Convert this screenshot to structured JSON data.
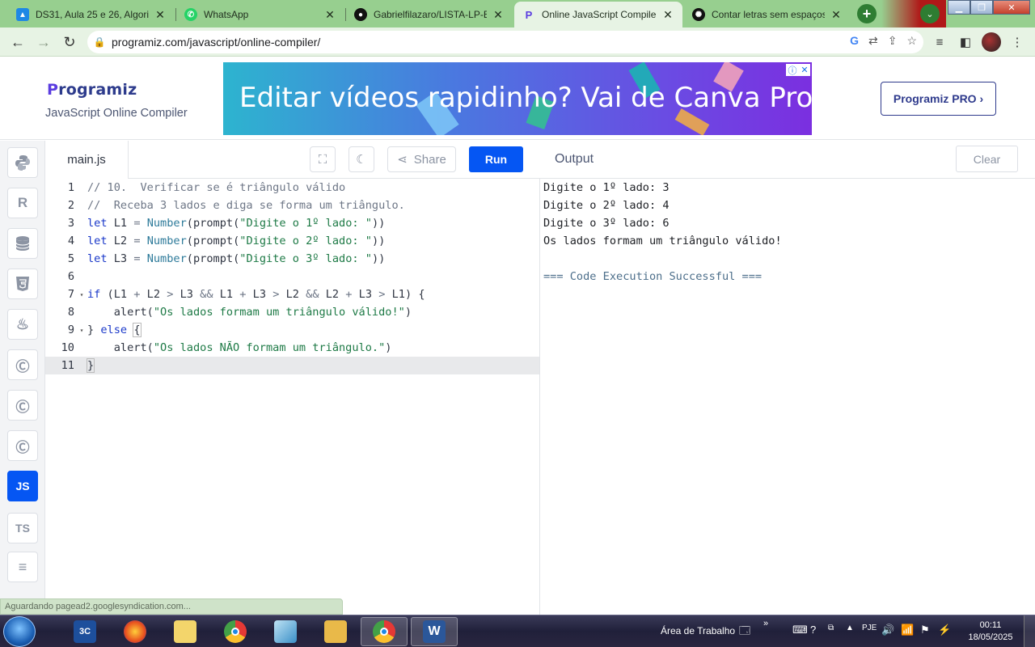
{
  "browser": {
    "tabs": [
      {
        "title": "DS31, Aula 25 e 26, Algoritmos",
        "icon": "classroom-icon",
        "color": "#1e88e5"
      },
      {
        "title": "WhatsApp",
        "icon": "whatsapp-icon",
        "color": "#25d366"
      },
      {
        "title": "Gabrielfilazaro/LISTA-LP-ET",
        "icon": "github-icon",
        "color": "#111111"
      },
      {
        "title": "Online JavaScript Compiler",
        "icon": "programiz-icon",
        "color": "#5a3ce0"
      },
      {
        "title": "Contar letras sem espaços",
        "icon": "openai-icon",
        "color": "#111111"
      }
    ],
    "url": "programiz.com/javascript/online-compiler/"
  },
  "header": {
    "logo_first": "P",
    "logo_rest": "rogramiz",
    "subtitle": "JavaScript Online Compiler",
    "ad_text": "Editar vídeos rapidinho? Vai de Canva Pro!",
    "pro_button": "Programiz PRO ›"
  },
  "languages": [
    "python",
    "r",
    "sql",
    "html",
    "java",
    "c",
    "cpp",
    "csharp",
    "JS",
    "TS",
    "go"
  ],
  "editor": {
    "file_tab": "main.js",
    "share_label": "Share",
    "run_label": "Run",
    "current_line": 11
  },
  "output": {
    "title": "Output",
    "clear_label": "Clear",
    "lines": [
      "Digite o 1º lado: 3",
      "Digite o 2º lado: 4",
      "Digite o 3º lado: 6",
      "Os lados formam um triângulo válido!",
      "",
      "=== Code Execution Successful ==="
    ]
  },
  "status_text": "Aguardando pagead2.googlesyndication.com...",
  "taskbar": {
    "desktop_label": "Área de Trabalho",
    "time": "00:11",
    "date": "18/05/2025"
  },
  "colors": {
    "accent": "#0556f3",
    "browser_frame": "#97cf8f"
  }
}
